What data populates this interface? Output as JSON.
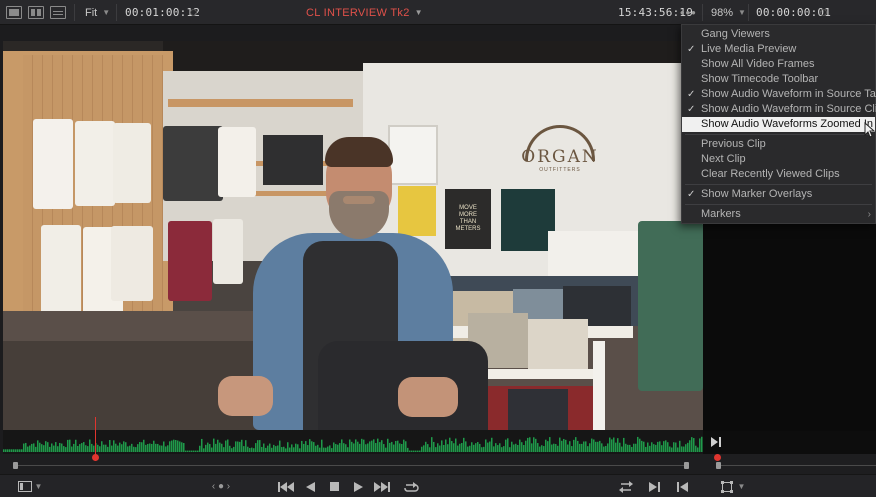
{
  "toolbar": {
    "fit_label": "Fit",
    "source_timecode": "00:01:00:12",
    "clip_name": "CL INTERVIEW Tk2",
    "record_timecode": "15:43:56:19",
    "more_dots": "•••",
    "zoom": "98%",
    "duration_timecode": "00:00:00:01"
  },
  "options_menu": {
    "items": [
      {
        "label": "Gang Viewers",
        "checked": false
      },
      {
        "label": "Live Media Preview",
        "checked": true
      },
      {
        "label": "Show All Video Frames",
        "checked": false
      },
      {
        "label": "Show Timecode Toolbar",
        "checked": false
      },
      {
        "label": "Show Audio Waveform in Source Tape",
        "checked": true
      },
      {
        "label": "Show Audio Waveform in Source Clip",
        "checked": true
      },
      {
        "label": "Show Audio Waveforms Zoomed In",
        "checked": false,
        "highlighted": true
      },
      {
        "label": "Previous Clip",
        "checked": false
      },
      {
        "label": "Next Clip",
        "checked": false
      },
      {
        "label": "Clear Recently Viewed Clips",
        "checked": false
      },
      {
        "label": "Show Marker Overlays",
        "checked": true
      },
      {
        "label": "Markers",
        "checked": false,
        "submenu": true
      }
    ],
    "check_glyph": "✓",
    "submenu_glyph": "›"
  },
  "scene": {
    "store_sign_line1": "ORGAN",
    "store_sign_line2": "OUTFITTERS",
    "poster_text": "MOVE MORE THAN METERS"
  },
  "transport": {
    "jog_label": "‹ ● ›"
  },
  "colors": {
    "clip_title": "#e0514a",
    "playhead": "#e0352f",
    "waveform": "#1f9a4a",
    "menu_highlight": "#f0f0f0"
  },
  "icons": {
    "layout": "viewer-layout-icon",
    "dropdown": "chevron-down-icon",
    "check": "check-icon",
    "submenu": "chevron-right-icon",
    "cursor": "mouse-pointer-icon"
  }
}
